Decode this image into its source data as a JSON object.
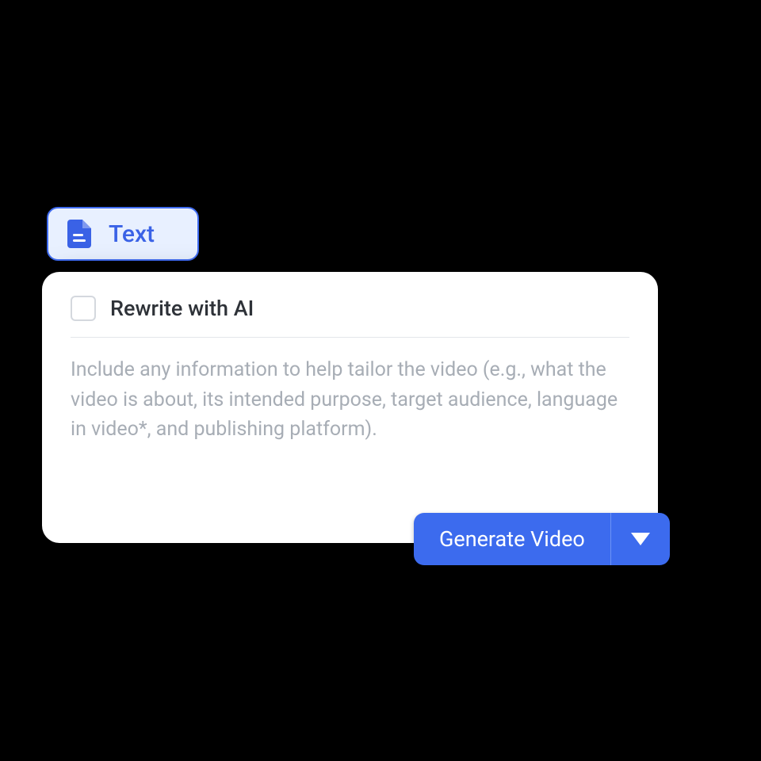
{
  "tab": {
    "label": "Text"
  },
  "card": {
    "rewrite_label": "Rewrite with AI",
    "placeholder": "Include any information to help tailor the video (e.g., what the video is about,  its intended purpose, target audience, language in video*, and publishing platform)."
  },
  "buttons": {
    "generate_label": "Generate Video"
  },
  "colors": {
    "accent": "#3C6BEE",
    "accent_light": "#E8F0FF",
    "text": "#2E3238",
    "muted": "#A7ADB5",
    "border": "#D4D8DE"
  }
}
